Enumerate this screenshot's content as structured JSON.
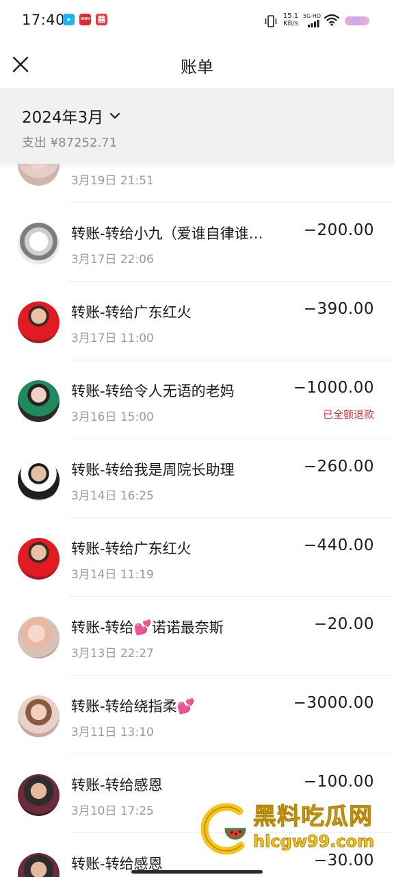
{
  "status_bar": {
    "time": "17:40",
    "app_badges": [
      "e",
      "IHBN",
      "囍"
    ],
    "net_speed_value": "15.1",
    "net_speed_unit": "KB/s",
    "signal_label": "5G HD"
  },
  "header": {
    "title": "账单"
  },
  "month": {
    "label": "2024年3月",
    "expense": "支出 ¥87252.71"
  },
  "transactions": [
    {
      "title": "",
      "time": "3月19日 21:51",
      "amount": "",
      "refund": ""
    },
    {
      "title": "转账-转给小九（爱谁自律谁…",
      "time": "3月17日 22:06",
      "amount": "−200.00",
      "refund": ""
    },
    {
      "title": "转账-转给广东红火",
      "time": "3月17日 11:00",
      "amount": "−390.00",
      "refund": ""
    },
    {
      "title": "转账-转给令人无语的老妈",
      "time": "3月16日 15:00",
      "amount": "−1000.00",
      "refund": "已全额退款"
    },
    {
      "title": "转账-转给我是周院长助理",
      "time": "3月14日 16:25",
      "amount": "−260.00",
      "refund": ""
    },
    {
      "title": "转账-转给广东红火",
      "time": "3月14日 11:19",
      "amount": "−440.00",
      "refund": ""
    },
    {
      "title": "转账-转给💕诺诺最奈斯",
      "time": "3月13日 22:27",
      "amount": "−20.00",
      "refund": ""
    },
    {
      "title": "转账-转给绕指柔💕",
      "time": "3月11日 13:10",
      "amount": "−3000.00",
      "refund": ""
    },
    {
      "title": "转账-转给感恩",
      "time": "3月10日 17:25",
      "amount": "−100.00",
      "refund": ""
    },
    {
      "title": "转账-转给感恩",
      "time": "",
      "amount": "−30.00",
      "refund": ""
    }
  ],
  "watermark": {
    "name": "黑料吃瓜网",
    "url": "hlcgw99.com"
  },
  "colors": {
    "header_bg": "#f1f1f1",
    "refund_red": "#d9363e",
    "secondary_text": "#9a9a9a",
    "watermark_gold": "#f7c21a"
  }
}
